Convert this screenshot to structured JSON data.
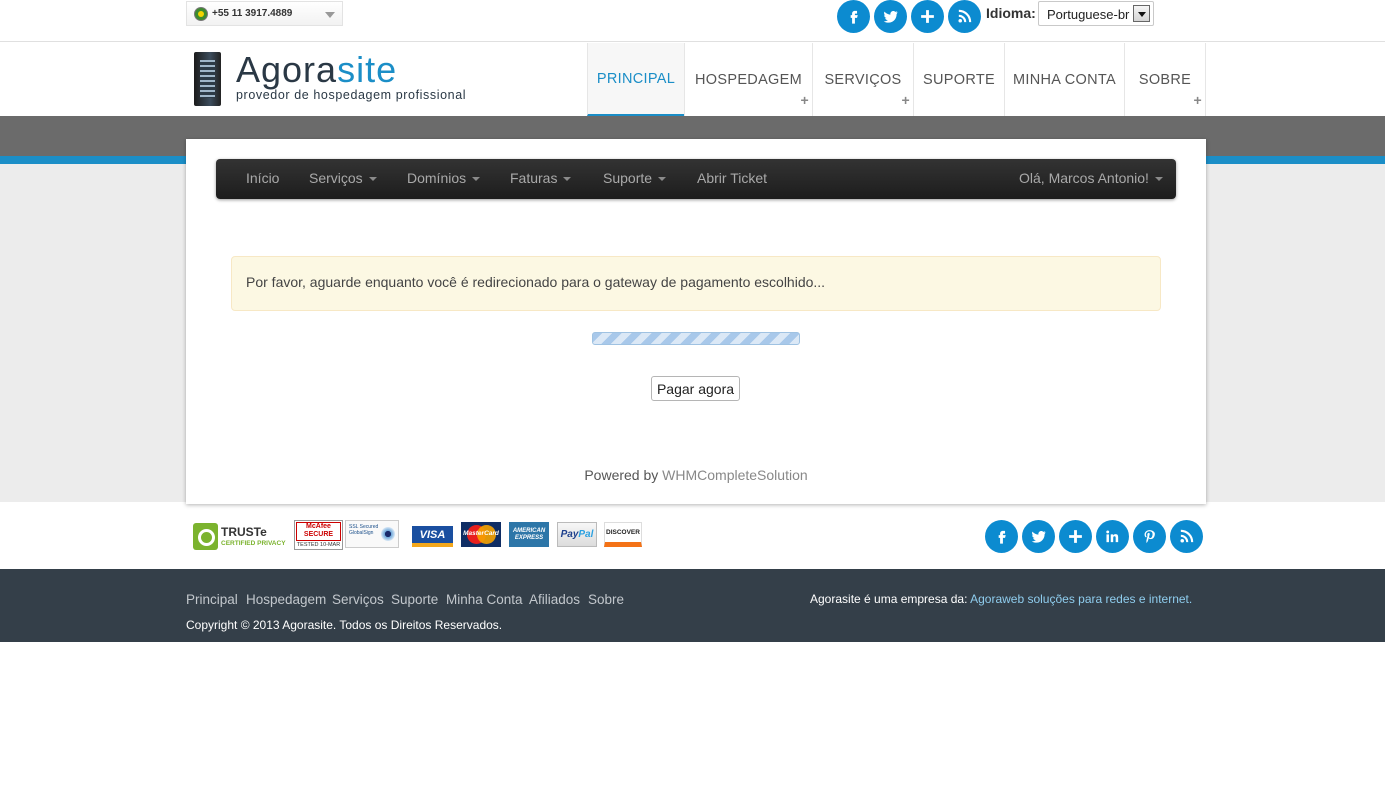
{
  "topbar": {
    "phone": "+55 11 3917.4889",
    "idioma_label": "Idioma:",
    "language": "Portuguese-br",
    "social_icons": [
      "facebook-icon",
      "twitter-icon",
      "plus-icon",
      "rss-icon"
    ]
  },
  "header": {
    "logo_name_main": "Agora",
    "logo_name_suffix": "site",
    "logo_tagline": "provedor de hospedagem profissional",
    "nav": [
      {
        "label": "PRINCIPAL",
        "active": true,
        "plus": false
      },
      {
        "label": "HOSPEDAGEM",
        "active": false,
        "plus": true
      },
      {
        "label": "SERVIÇOS",
        "active": false,
        "plus": true
      },
      {
        "label": "SUPORTE",
        "active": false,
        "plus": false
      },
      {
        "label": "MINHA CONTA",
        "active": false,
        "plus": false
      },
      {
        "label": "SOBRE",
        "active": false,
        "plus": true
      }
    ]
  },
  "subnav": {
    "items": [
      {
        "label": "Início",
        "dropdown": false
      },
      {
        "label": "Serviços",
        "dropdown": true
      },
      {
        "label": "Domínios",
        "dropdown": true
      },
      {
        "label": "Faturas",
        "dropdown": true
      },
      {
        "label": "Suporte",
        "dropdown": true
      },
      {
        "label": "Abrir Ticket",
        "dropdown": false
      }
    ],
    "user_greeting": "Olá, Marcos Antonio!"
  },
  "main": {
    "alert_text": "Por favor, aguarde enquanto você é redirecionado para o gateway de pagamento escolhido...",
    "pay_button": "Pagar agora",
    "powered_prefix": "Powered by",
    "powered_link": "WHMCompleteSolution"
  },
  "badges": {
    "truste_name": "TRUSTe",
    "truste_sub": "CERTIFIED PRIVACY",
    "mcafee_name": "McAfee SECURE",
    "mcafee_date": "TESTED 10-MAR",
    "globalsign_text": "SSL Secured GlobalSign",
    "visa": "VISA",
    "mastercard": "MasterCard",
    "amex": "AMERICAN EXPRESS",
    "paypal_a": "Pay",
    "paypal_b": "Pal",
    "discover": "DISCOVER"
  },
  "footer": {
    "social_icons": [
      "facebook-icon",
      "twitter-icon",
      "plus-icon",
      "linkedin-icon",
      "pinterest-icon",
      "rss-icon"
    ],
    "links": [
      "Principal",
      "Hospedagem",
      "Serviços",
      "Suporte",
      "Minha Conta",
      "Afiliados",
      "Sobre"
    ],
    "copyright": "Copyright © 2013 Agorasite. Todos os Direitos Reservados.",
    "company_prefix": "Agorasite é uma empresa da:",
    "company_link": "Agoraweb soluções para redes e internet",
    "company_suffix": "."
  },
  "colors": {
    "accent": "#1b8ec7",
    "footer_bg": "#343f49",
    "alert_bg": "#fcf8e3"
  }
}
